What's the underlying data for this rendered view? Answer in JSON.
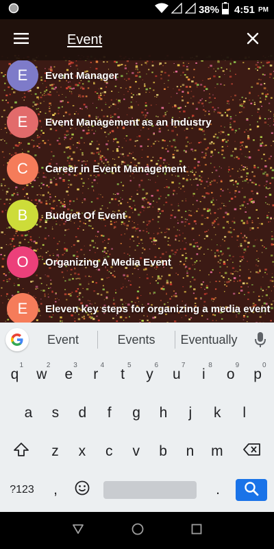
{
  "status_bar": {
    "battery": "38%",
    "time": "4:51",
    "ampm": "PM",
    "icons": [
      "notification-dot-icon",
      "wifi-icon",
      "signal-icon",
      "signal-icon",
      "battery-icon"
    ]
  },
  "app_bar": {
    "search_text": "Event",
    "icons": [
      "menu-icon",
      "close-icon"
    ]
  },
  "results": [
    {
      "letter": "E",
      "title": "Event Manager",
      "color": "#7e7bc9"
    },
    {
      "letter": "E",
      "title": "Event Management as an Industry",
      "color": "#e26b6b"
    },
    {
      "letter": "C",
      "title": "Career in Event Management",
      "color": "#f57c5a"
    },
    {
      "letter": "B",
      "title": "Budget Of Event",
      "color": "#cddc39"
    },
    {
      "letter": "O",
      "title": "Organizing A Media Event",
      "color": "#ec407a"
    },
    {
      "letter": "E",
      "title": "Eleven key steps for organizing a media event",
      "color": "#f57c5a"
    }
  ],
  "keyboard": {
    "suggestions": [
      "Event",
      "Events",
      "Eventually"
    ],
    "row1": [
      {
        "k": "q",
        "h": "1"
      },
      {
        "k": "w",
        "h": "2"
      },
      {
        "k": "e",
        "h": "3"
      },
      {
        "k": "r",
        "h": "4"
      },
      {
        "k": "t",
        "h": "5"
      },
      {
        "k": "y",
        "h": "6"
      },
      {
        "k": "u",
        "h": "7"
      },
      {
        "k": "i",
        "h": "8"
      },
      {
        "k": "o",
        "h": "9"
      },
      {
        "k": "p",
        "h": "0"
      }
    ],
    "row2": [
      "a",
      "s",
      "d",
      "f",
      "g",
      "h",
      "j",
      "k",
      "l"
    ],
    "row3": [
      "z",
      "x",
      "c",
      "v",
      "b",
      "n",
      "m"
    ],
    "symbols_label": "?123",
    "comma": ",",
    "period": ".",
    "accent_color": "#1a73e8",
    "icons": [
      "google-icon",
      "mic-icon",
      "shift-icon",
      "backspace-icon",
      "emoji-icon",
      "search-icon"
    ]
  },
  "nav_bar": {
    "icons": [
      "back-icon",
      "home-icon",
      "recents-icon"
    ]
  }
}
